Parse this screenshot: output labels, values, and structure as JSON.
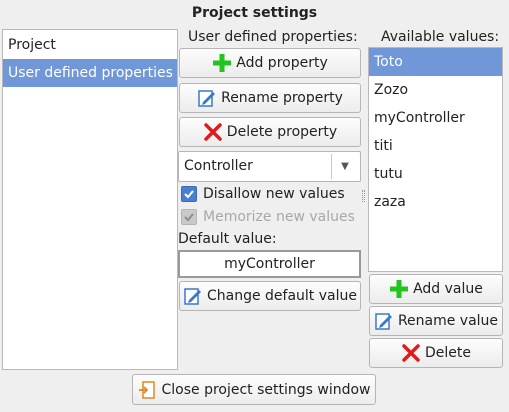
{
  "window": {
    "title": "Project settings"
  },
  "categories": {
    "items": [
      {
        "label": "Project",
        "selected": false
      },
      {
        "label": "User defined properties",
        "selected": true
      }
    ]
  },
  "properties": {
    "header": "User defined properties:",
    "add_label": "Add property",
    "rename_label": "Rename property",
    "delete_label": "Delete property",
    "selected_property": "Controller",
    "disallow_new_values": {
      "label": "Disallow new values",
      "checked": true
    },
    "memorize_new_values": {
      "label": "Memorize new values",
      "checked": true,
      "enabled": false
    },
    "default_value_label": "Default value:",
    "default_value": "myController",
    "change_default_label": "Change default value"
  },
  "values": {
    "header": "Available values:",
    "items": [
      {
        "label": "Toto",
        "selected": true
      },
      {
        "label": "Zozo",
        "selected": false
      },
      {
        "label": "myController",
        "selected": false
      },
      {
        "label": "titi",
        "selected": false
      },
      {
        "label": "tutu",
        "selected": false
      },
      {
        "label": "zaza",
        "selected": false
      }
    ],
    "add_label": "Add value",
    "rename_label": "Rename value",
    "delete_label": "Delete"
  },
  "footer": {
    "close_label": "Close project settings window"
  },
  "colors": {
    "selection": "#7098d8",
    "add_icon": "#22c41e",
    "delete_icon": "#e01b1b",
    "edit_icon": "#3a78c9",
    "close_icon": "#e08a1e"
  },
  "icons": {
    "add": "plus-icon",
    "rename": "edit-icon",
    "delete": "x-icon",
    "close": "exit-door-icon",
    "dropdown": "chevron-down-icon",
    "check": "checkmark-icon"
  }
}
